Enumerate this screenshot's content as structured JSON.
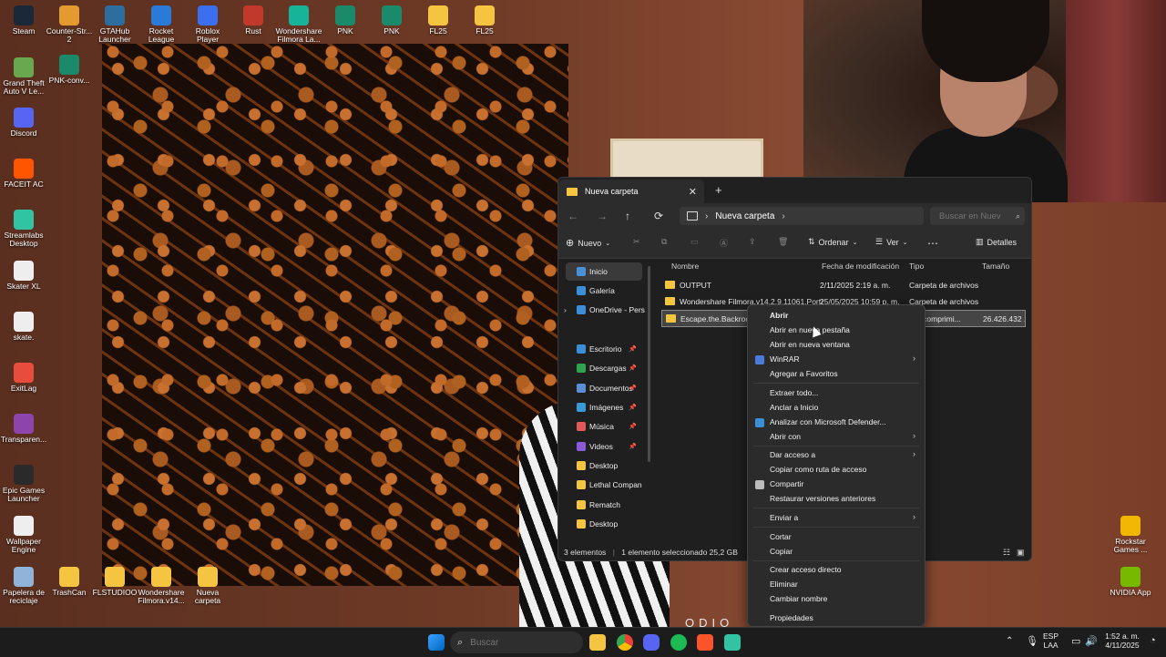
{
  "desktop": {
    "icons_top": [
      {
        "label": "Steam",
        "color": "#1b2838"
      },
      {
        "label": "Counter-Str... 2",
        "color": "#e59a2f"
      },
      {
        "label": "GTAHub Launcher",
        "color": "#2e6e9e"
      },
      {
        "label": "Rocket League",
        "color": "#2a7bd8"
      },
      {
        "label": "Roblox Player",
        "color": "#3b6ff0"
      },
      {
        "label": "Rust",
        "color": "#c0392b"
      },
      {
        "label": "Wondershare Filmora La...",
        "color": "#18b49a"
      },
      {
        "label": "PNK",
        "color": "#1a8a6a"
      },
      {
        "label": "PNK",
        "color": "#1a8a6a"
      },
      {
        "label": "FL25",
        "color": "#f5c542"
      },
      {
        "label": "FL25",
        "color": "#f5c542"
      }
    ],
    "icons_left": [
      {
        "label": "Grand Theft Auto V Le...",
        "color": "#6aa84f"
      },
      {
        "label": "PNK-conv...",
        "color": "#1a8a6a"
      },
      {
        "label": "Discord",
        "color": "#5865f2"
      },
      {
        "label": "FACEIT AC",
        "color": "#ff5500"
      },
      {
        "label": "Streamlabs Desktop",
        "color": "#31c3a2"
      },
      {
        "label": "Skater XL",
        "color": "#eeeeee"
      },
      {
        "label": "skate.",
        "color": "#eeeeee"
      },
      {
        "label": "ExitLag",
        "color": "#e74c3c"
      },
      {
        "label": "Transparen...",
        "color": "#8e44ad"
      },
      {
        "label": "Epic Games Launcher",
        "color": "#2a2a2a"
      },
      {
        "label": "Wallpaper Engine",
        "color": "#eeeeee"
      }
    ],
    "icons_bottom": [
      {
        "label": "Papelera de reciclaje",
        "color": "#8fb3d9"
      },
      {
        "label": "TrashCan",
        "color": "#f5c542"
      },
      {
        "label": "FLSTUDIOO",
        "color": "#f5c542"
      },
      {
        "label": "Wondershare Filmora.v14...",
        "color": "#f5c542"
      },
      {
        "label": "Nueva carpeta",
        "color": "#f5c542"
      }
    ],
    "icons_right": [
      {
        "label": "Rockstar Games ...",
        "color": "#f2b705"
      },
      {
        "label": "NVIDIA App",
        "color": "#76b900"
      }
    ],
    "overlay_text": "ODIO"
  },
  "explorer": {
    "tab_title": "Nueva carpeta",
    "breadcrumb": "Nueva carpeta",
    "search_placeholder": "Buscar en Nuev",
    "toolbar": {
      "new_label": "Nuevo",
      "sort_label": "Ordenar",
      "view_label": "Ver",
      "details_label": "Detalles"
    },
    "sidebar": [
      {
        "label": "Inicio",
        "color": "#4a90d9"
      },
      {
        "label": "Galería",
        "color": "#3a8fd8"
      },
      {
        "label": "OneDrive - Pers",
        "color": "#3a8fd8"
      },
      {
        "label": "Escritorio",
        "color": "#3a8fd8"
      },
      {
        "label": "Descargas",
        "color": "#2ea44f"
      },
      {
        "label": "Documentos",
        "color": "#5a8fd8"
      },
      {
        "label": "Imágenes",
        "color": "#3a9ad8"
      },
      {
        "label": "Música",
        "color": "#e05a5a"
      },
      {
        "label": "Videos",
        "color": "#8a5ad8"
      },
      {
        "label": "Desktop",
        "color": "#f5c542"
      },
      {
        "label": "Lethal Compan",
        "color": "#f5c542"
      },
      {
        "label": "Rematch",
        "color": "#f5c542"
      },
      {
        "label": "Desktop",
        "color": "#f5c542"
      }
    ],
    "columns": {
      "name": "Nombre",
      "date": "Fecha de modificación",
      "type": "Tipo",
      "size": "Tamaño"
    },
    "files": [
      {
        "name": "OUTPUT",
        "date": "2/11/2025 2:19 a. m.",
        "type": "Carpeta de archivos",
        "size": ""
      },
      {
        "name": "Wondershare Filmora.v14.2.9.11061.Porta...",
        "date": "25/05/2025 10:59 p. m.",
        "type": "Carpeta de archivos",
        "size": ""
      },
      {
        "name": "Escape.the.Backrooms",
        "date": "",
        "type": "eta comprimi...",
        "size": "26.426.432 ..."
      }
    ],
    "status": {
      "count": "3 elementos",
      "selection": "1 elemento seleccionado  25,2 GB"
    }
  },
  "context_menu": {
    "items": [
      {
        "label": "Abrir",
        "bold": true,
        "sub": false
      },
      {
        "label": "Abrir en nueva pestaña",
        "bold": false,
        "sub": false
      },
      {
        "label": "Abrir en nueva ventana",
        "bold": false,
        "sub": false
      },
      {
        "label": "WinRAR",
        "bold": false,
        "sub": true
      },
      {
        "label": "Agregar a Favoritos",
        "bold": false,
        "sub": false
      },
      {
        "label": "Extraer todo...",
        "bold": false,
        "sub": false
      },
      {
        "label": "Anclar a Inicio",
        "bold": false,
        "sub": false
      },
      {
        "label": "Analizar con Microsoft Defender...",
        "bold": false,
        "sub": false
      },
      {
        "label": "Abrir con",
        "bold": false,
        "sub": true
      },
      {
        "label": "Dar acceso a",
        "bold": false,
        "sub": true
      },
      {
        "label": "Copiar como ruta de acceso",
        "bold": false,
        "sub": false
      },
      {
        "label": "Compartir",
        "bold": false,
        "sub": false
      },
      {
        "label": "Restaurar versiones anteriores",
        "bold": false,
        "sub": false
      },
      {
        "label": "Enviar a",
        "bold": false,
        "sub": true
      },
      {
        "label": "Cortar",
        "bold": false,
        "sub": false
      },
      {
        "label": "Copiar",
        "bold": false,
        "sub": false
      },
      {
        "label": "Crear acceso directo",
        "bold": false,
        "sub": false
      },
      {
        "label": "Eliminar",
        "bold": false,
        "sub": false
      },
      {
        "label": "Cambiar nombre",
        "bold": false,
        "sub": false
      },
      {
        "label": "Propiedades",
        "bold": false,
        "sub": false
      }
    ]
  },
  "taskbar": {
    "search_placeholder": "Buscar",
    "lang": "ESP",
    "lang_sub": "LAA",
    "time": "1:52 a. m.",
    "date": "4/11/2025"
  }
}
